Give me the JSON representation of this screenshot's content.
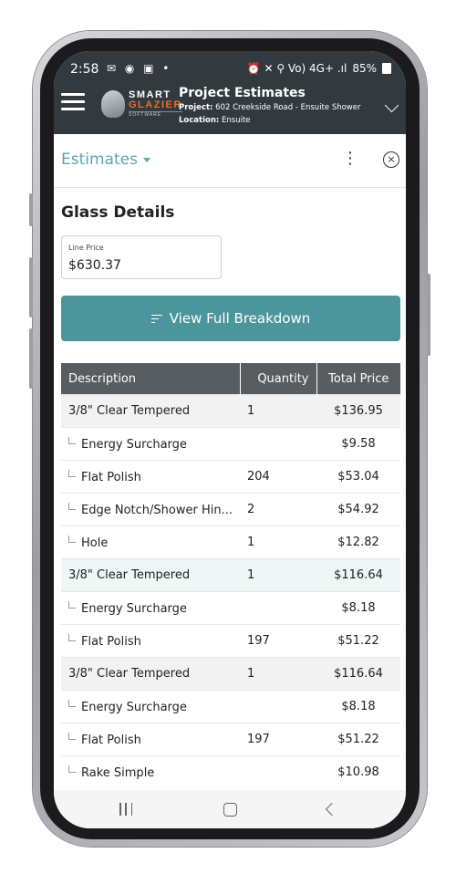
{
  "status_bar": {
    "time": "2:58",
    "left_icons": "✉ ◉ ▣ •",
    "right_icons": "⏰ ✕ ⚲ Vo) 4G+ .ıl",
    "battery": "85%"
  },
  "app_bar": {
    "title": "Project Estimates",
    "project_label": "Project:",
    "project_value": "602 Creekside Road - Ensuite Shower",
    "location_label": "Location:",
    "location_value": "Ensuite"
  },
  "logo": {
    "line1": "SMART",
    "line2": "GLAZIER",
    "line3": "SOFTWARE"
  },
  "estimates_header": {
    "title": "Estimates",
    "more_icon": "⋮",
    "close_icon": "×"
  },
  "glass_details": {
    "title": "Glass Details",
    "line_price_label": "Line Price",
    "line_price_value": "$630.37",
    "breakdown_button": "View Full Breakdown"
  },
  "table": {
    "columns": [
      "Description",
      "Quantity",
      "Total Price"
    ],
    "rows": [
      {
        "description": "3/8\" Clear Tempered",
        "quantity": "1",
        "total": "$136.95",
        "type": "parent"
      },
      {
        "description": "Energy Surcharge",
        "quantity": "",
        "total": "$9.58",
        "type": "child"
      },
      {
        "description": "Flat Polish",
        "quantity": "204",
        "total": "$53.04",
        "type": "child"
      },
      {
        "description": "Edge Notch/Shower Hin...",
        "quantity": "2",
        "total": "$54.92",
        "type": "child"
      },
      {
        "description": "Hole",
        "quantity": "1",
        "total": "$12.82",
        "type": "child"
      },
      {
        "description": "3/8\" Clear Tempered",
        "quantity": "1",
        "total": "$116.64",
        "type": "parent-hl"
      },
      {
        "description": "Energy Surcharge",
        "quantity": "",
        "total": "$8.18",
        "type": "child"
      },
      {
        "description": "Flat Polish",
        "quantity": "197",
        "total": "$51.22",
        "type": "child"
      },
      {
        "description": "3/8\" Clear Tempered",
        "quantity": "1",
        "total": "$116.64",
        "type": "parent"
      },
      {
        "description": "Energy Surcharge",
        "quantity": "",
        "total": "$8.18",
        "type": "child"
      },
      {
        "description": "Flat Polish",
        "quantity": "197",
        "total": "$51.22",
        "type": "child"
      },
      {
        "description": "Rake Simple",
        "quantity": "",
        "total": "$10.98",
        "type": "child"
      }
    ]
  },
  "colors": {
    "accent": "#4c959c",
    "title_teal": "#5fa7ad",
    "app_bar": "#323a3f",
    "table_header": "#575d61",
    "brand_orange": "#e2702a"
  }
}
